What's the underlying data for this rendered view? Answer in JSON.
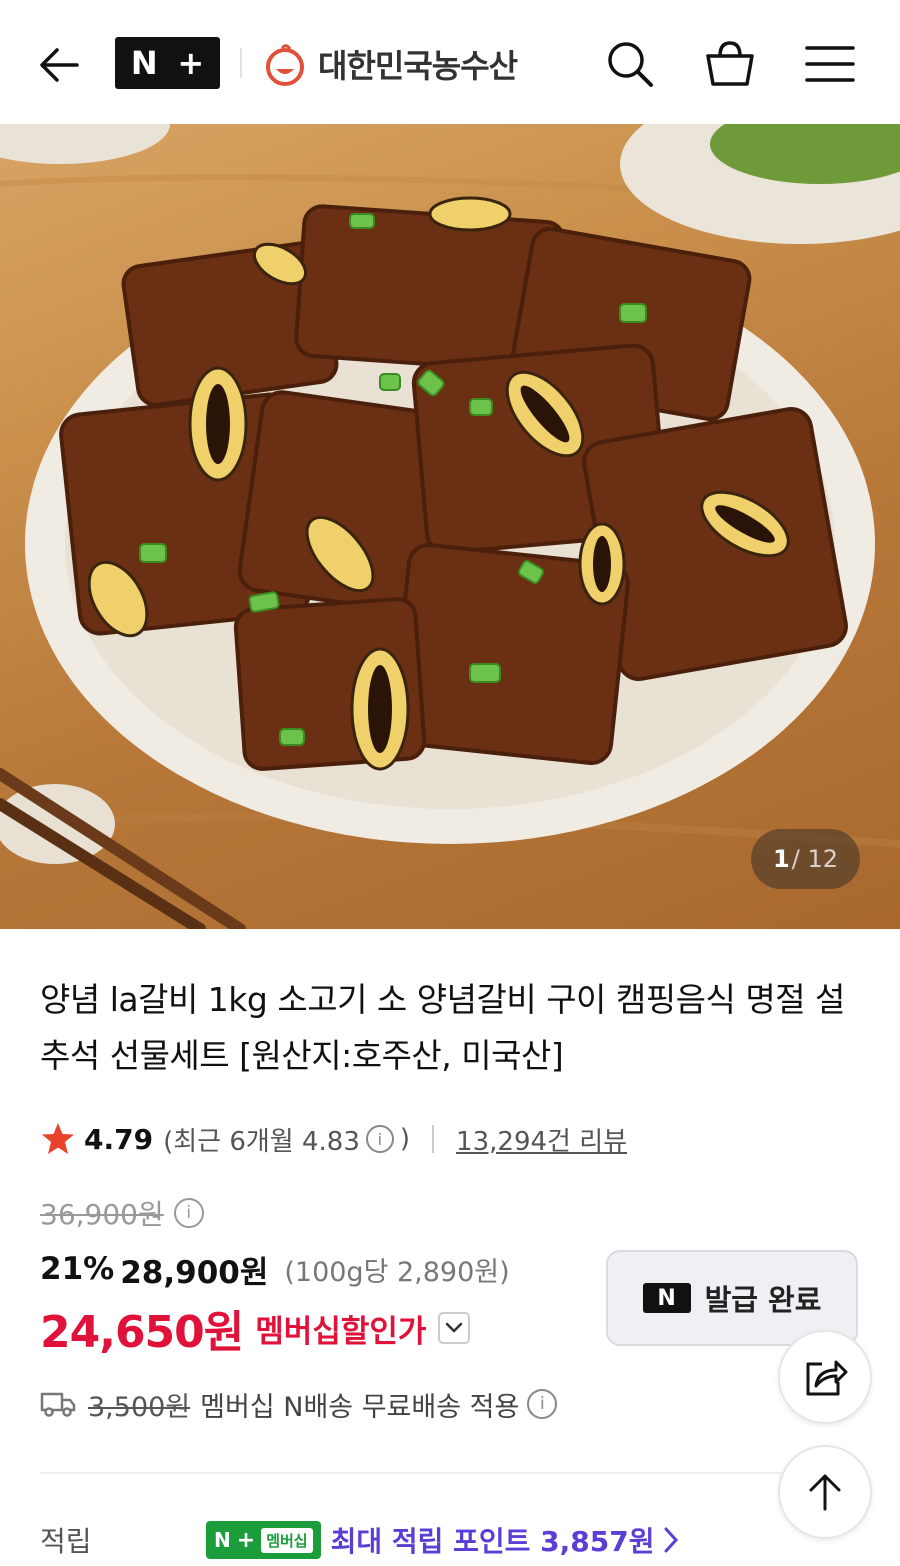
{
  "header": {
    "nplus_logo": [
      "N",
      "+"
    ],
    "brand_name": "대한민국농수산",
    "icons": [
      "back-arrow-icon",
      "search-icon",
      "shopping-basket-icon",
      "hamburger-menu-icon"
    ]
  },
  "gallery": {
    "current": "1",
    "total": "/ 12"
  },
  "product": {
    "title": "양념 la갈비 1kg 소고기 소 양념갈비 구이 캠핑음식 명절 설 추석 선물세트 [원산지:호주산, 미국산]"
  },
  "rating": {
    "score": "4.79",
    "recent_label": "(최근 6개월 4.83",
    "recent_close": ")",
    "reviews": "13,294건 리뷰"
  },
  "price": {
    "original": "36,900원",
    "discount": "21%",
    "sale": "28,900원",
    "unit_price": "(100g당 2,890원)",
    "member_price": "24,650원",
    "member_label": "멤버십할인가"
  },
  "coupon": {
    "logo": "N",
    "label": "발급 완료"
  },
  "shipping": {
    "original_fee": "3,500원",
    "text": "멤버십 N배송 무료배송 적용"
  },
  "points": {
    "label": "적립",
    "badge_n": "N",
    "badge_plus": "+",
    "badge_member": "멤버십",
    "text": "최대 적립 포인트 3,857원"
  },
  "colors": {
    "accent_red": "#e0123a",
    "points_purple": "#5a3fd6",
    "membership_green": "#1a9d3a",
    "star": "#e8412c"
  }
}
